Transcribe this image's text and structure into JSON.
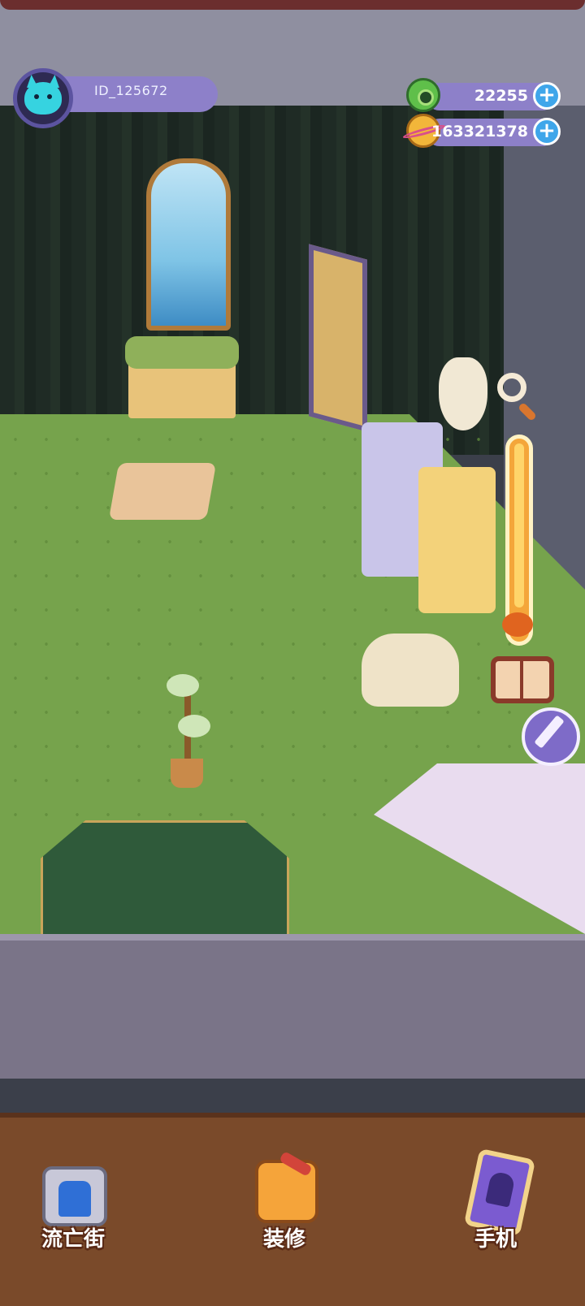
{
  "player": {
    "id": "ID_125672"
  },
  "currency": {
    "green": {
      "value": "22255",
      "icon": "donut-coin-icon"
    },
    "gold": {
      "value": "163321378",
      "icon": "planet-coin-icon"
    }
  },
  "zoom": {
    "level": 0.85
  },
  "nav": {
    "street": {
      "label": "流亡街",
      "icon": "portal-icon"
    },
    "decorate": {
      "label": "装修",
      "icon": "paint-roller-icon"
    },
    "phone": {
      "label": "手机",
      "icon": "phone-icon"
    }
  },
  "colors": {
    "hud_bar": "#8d80c9",
    "plus_button": "#3fa6ea",
    "grass": "#76a34c"
  }
}
